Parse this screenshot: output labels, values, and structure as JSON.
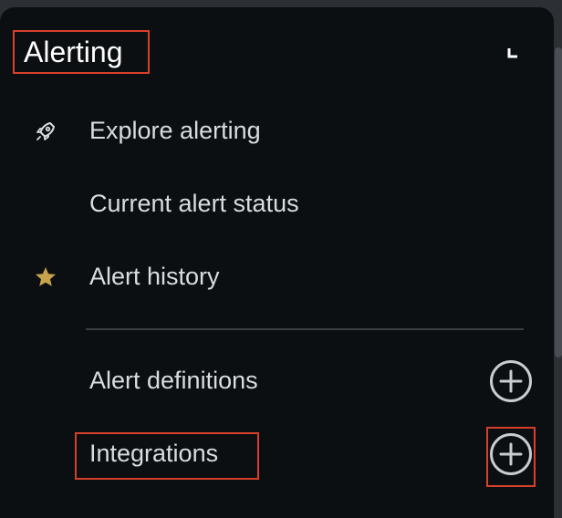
{
  "panel": {
    "title": "Alerting",
    "corner_icon": "collapse-corner-icon"
  },
  "menu": {
    "items": [
      {
        "label": "Explore alerting",
        "icon": "rocket-icon"
      },
      {
        "label": "Current alert status",
        "icon": ""
      },
      {
        "label": "Alert history",
        "icon": "star-icon"
      },
      {
        "label": "Alert definitions",
        "icon": "",
        "action": "add-circle-icon"
      },
      {
        "label": "Integrations",
        "icon": "",
        "action": "add-circle-icon"
      }
    ]
  },
  "colors": {
    "panel_bg": "#0c0f11",
    "text": "#d9dde1",
    "title": "#ffffff",
    "star": "#c9a24e",
    "highlight": "#d6402b"
  }
}
